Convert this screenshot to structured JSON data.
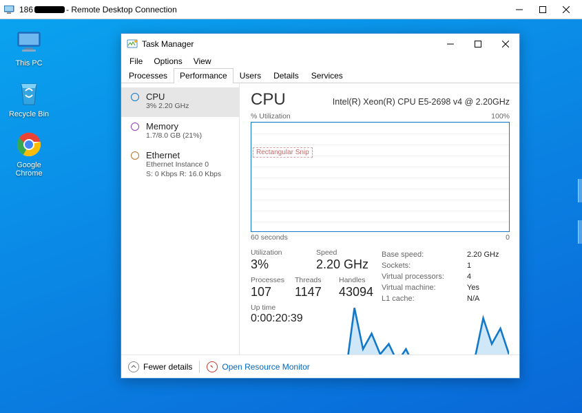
{
  "rdp": {
    "ip_prefix": "186",
    "title_suffix": "- Remote Desktop Connection"
  },
  "desktop": {
    "icons": {
      "this_pc": "This PC",
      "recycle_bin": "Recycle Bin",
      "chrome": "Google Chrome"
    }
  },
  "tm": {
    "title": "Task Manager",
    "menu": {
      "file": "File",
      "options": "Options",
      "view": "View"
    },
    "tabs": {
      "processes": "Processes",
      "performance": "Performance",
      "users": "Users",
      "details": "Details",
      "services": "Services"
    },
    "side": {
      "cpu": {
        "title": "CPU",
        "sub": "3%  2.20 GHz",
        "color": "#1278c7"
      },
      "memory": {
        "title": "Memory",
        "sub": "1.7/8.0 GB (21%)",
        "color": "#8b3fbf"
      },
      "ethernet": {
        "title": "Ethernet",
        "sub1": "Ethernet Instance 0",
        "sub2": "S: 0 Kbps  R: 16.0 Kbps",
        "color": "#b9742b"
      }
    },
    "main": {
      "heading": "CPU",
      "cpu_name": "Intel(R) Xeon(R) CPU E5-2698 v4 @ 2.20GHz",
      "chart_top_left": "% Utilization",
      "chart_top_right": "100%",
      "chart_bottom_left": "60 seconds",
      "chart_bottom_right": "0",
      "snip_text": "Rectangular Snip",
      "stats": {
        "utilization_label": "Utilization",
        "utilization": "3%",
        "speed_label": "Speed",
        "speed": "2.20 GHz",
        "processes_label": "Processes",
        "processes": "107",
        "threads_label": "Threads",
        "threads": "1147",
        "handles_label": "Handles",
        "handles": "43094",
        "uptime_label": "Up time",
        "uptime": "0:00:20:39"
      },
      "right_stats": {
        "base_speed_k": "Base speed:",
        "base_speed_v": "2.20 GHz",
        "sockets_k": "Sockets:",
        "sockets_v": "1",
        "vproc_k": "Virtual processors:",
        "vproc_v": "4",
        "vm_k": "Virtual machine:",
        "vm_v": "Yes",
        "l1_k": "L1 cache:",
        "l1_v": "N/A"
      }
    },
    "footer": {
      "fewer_details": "Fewer details",
      "open_resource_monitor": "Open Resource Monitor"
    }
  },
  "chart_data": {
    "type": "line",
    "title": "CPU % Utilization",
    "xlabel": "seconds ago",
    "ylabel": "% Utilization",
    "ylim": [
      0,
      100
    ],
    "xlim_seconds": [
      60,
      0
    ],
    "x_seconds_ago": [
      60,
      58,
      56,
      54,
      52,
      50,
      48,
      46,
      44,
      42,
      40,
      38,
      36,
      34,
      32,
      30,
      28,
      26,
      24,
      22,
      20,
      18,
      16,
      14,
      12,
      10,
      8,
      6,
      4,
      2,
      0
    ],
    "values_pct": [
      2,
      2,
      2,
      2,
      2,
      2,
      2,
      2,
      2,
      2,
      2,
      3,
      28,
      12,
      18,
      10,
      14,
      7,
      12,
      5,
      6,
      5,
      4,
      4,
      5,
      6,
      8,
      24,
      14,
      20,
      10
    ]
  }
}
